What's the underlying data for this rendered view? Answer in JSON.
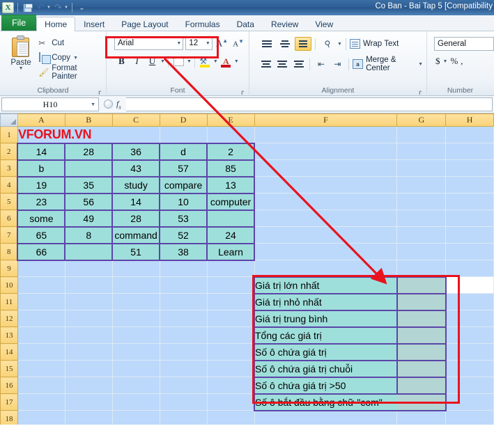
{
  "window": {
    "title": "Co Ban - Bai Tap 5  [Compatibility",
    "quick_access": [
      {
        "name": "excel-logo",
        "label": "X"
      },
      {
        "name": "save-icon",
        "label": ""
      },
      {
        "name": "undo-icon",
        "label": "↶"
      },
      {
        "name": "redo-icon",
        "label": "↷"
      },
      {
        "name": "customize-qat-icon",
        "label": "⌵"
      }
    ]
  },
  "ribbon": {
    "tabs": [
      {
        "label": "File",
        "active": false
      },
      {
        "label": "Home",
        "active": true
      },
      {
        "label": "Insert",
        "active": false
      },
      {
        "label": "Page Layout",
        "active": false
      },
      {
        "label": "Formulas",
        "active": false
      },
      {
        "label": "Data",
        "active": false
      },
      {
        "label": "Review",
        "active": false
      },
      {
        "label": "View",
        "active": false
      }
    ],
    "clipboard": {
      "group_label": "Clipboard",
      "paste_label": "Paste",
      "cut_label": "Cut",
      "copy_label": "Copy",
      "format_painter_label": "Format Painter"
    },
    "font": {
      "group_label": "Font",
      "font_name": "Arial",
      "font_size": "12",
      "grow_label": "A",
      "shrink_label": "A",
      "bold_label": "B",
      "italic_label": "I",
      "underline_label": "U",
      "fill_letter": "A"
    },
    "alignment": {
      "group_label": "Alignment",
      "wrap_text_label": "Wrap Text",
      "merge_center_label": "Merge & Center"
    },
    "number": {
      "group_label": "Number",
      "format_value": "General",
      "currency_label": "$",
      "percent_label": "%",
      "comma_label": ","
    }
  },
  "formula_bar": {
    "name_box": "H10",
    "fx_label": "fx",
    "formula_value": ""
  },
  "sheet": {
    "columns": [
      "A",
      "B",
      "C",
      "D",
      "E",
      "F",
      "G",
      "H"
    ],
    "rows": [
      "1",
      "2",
      "3",
      "4",
      "5",
      "6",
      "7",
      "8",
      "9",
      "10",
      "11",
      "12",
      "13",
      "14",
      "15",
      "16",
      "17",
      "18"
    ],
    "title_cell": "VFORUM.VN",
    "data_table": [
      [
        "14",
        "28",
        "36",
        "d",
        "2"
      ],
      [
        "b",
        "",
        "43",
        "57",
        "85"
      ],
      [
        "19",
        "35",
        "study",
        "compare",
        "13"
      ],
      [
        "23",
        "56",
        "14",
        "10",
        "computer"
      ],
      [
        "some",
        "49",
        "28",
        "53",
        ""
      ],
      [
        "65",
        "8",
        "command",
        "52",
        "24"
      ],
      [
        "66",
        "",
        "51",
        "38",
        "Learn"
      ]
    ],
    "result_labels": [
      "Giá trị lớn nhất",
      "Giá trị nhỏ nhất",
      "Giá trị trung bình",
      "Tổng các giá trị",
      "Số ô chứa giá trị",
      "Số ô chứa giá trị chuỗi",
      "Số ô chứa giá trị >50",
      "Số ô bắt đầu bằng chữ \"com\""
    ],
    "result_values": [
      "",
      "",
      "",
      "",
      "",
      "",
      "",
      ""
    ]
  },
  "colors": {
    "annotation_red": "#e8131d",
    "data_fill": "#9fdfdb",
    "data_border": "#5b45a8",
    "result_fill": "#b3d5d3",
    "selection_blue": "#bcd9fb",
    "header_yellow": "#f9d377",
    "title_red": "#e8131d"
  },
  "annotations": {
    "font_box_name": "font-group-highlight",
    "results_box_name": "results-area-highlight",
    "arrow_name": "red-arrow-font-to-results"
  }
}
